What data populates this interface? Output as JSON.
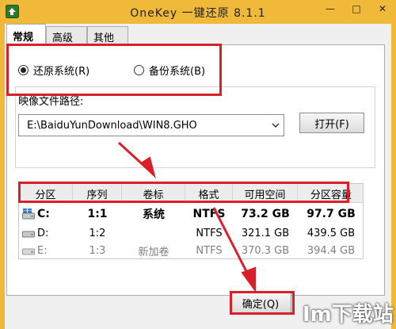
{
  "window": {
    "title": "OneKey 一键还原 8.1.1",
    "minimize_glyph": "—",
    "maximize_glyph": "□",
    "close_glyph": "✕"
  },
  "tabs": [
    {
      "label": "常规",
      "active": true
    },
    {
      "label": "高级",
      "active": false
    },
    {
      "label": "其他",
      "active": false
    }
  ],
  "mode": {
    "restore_label": "还原系统(R)",
    "backup_label": "备份系统(B)",
    "selected": "restore"
  },
  "image_path": {
    "label": "映像文件路径:",
    "value": "E:\\BaiduYunDownload\\WIN8.GHO",
    "open_button": "打开(F)"
  },
  "partition_table": {
    "columns": [
      "分区",
      "序列",
      "卷标",
      "格式",
      "可用空间",
      "分区容量"
    ],
    "rows": [
      {
        "drive": "C:",
        "seq": "1:1",
        "label": "系统",
        "format": "NTFS",
        "free": "73.2 GB",
        "capacity": "97.7 GB",
        "selected": true
      },
      {
        "drive": "D:",
        "seq": "1:2",
        "label": "",
        "format": "NTFS",
        "free": "321.1 GB",
        "capacity": "439.5 GB",
        "selected": false
      },
      {
        "drive": "E:",
        "seq": "1:3",
        "label": "新加卷",
        "format": "NTFS",
        "free": "370.3 GB",
        "capacity": "394.4 GB",
        "selected": false
      }
    ]
  },
  "footer": {
    "ok_button": "确定(Q)"
  },
  "watermark": {
    "text": "Im下载站"
  },
  "colors": {
    "titlebar": "#f0b93a",
    "highlight": "#d9202a"
  }
}
